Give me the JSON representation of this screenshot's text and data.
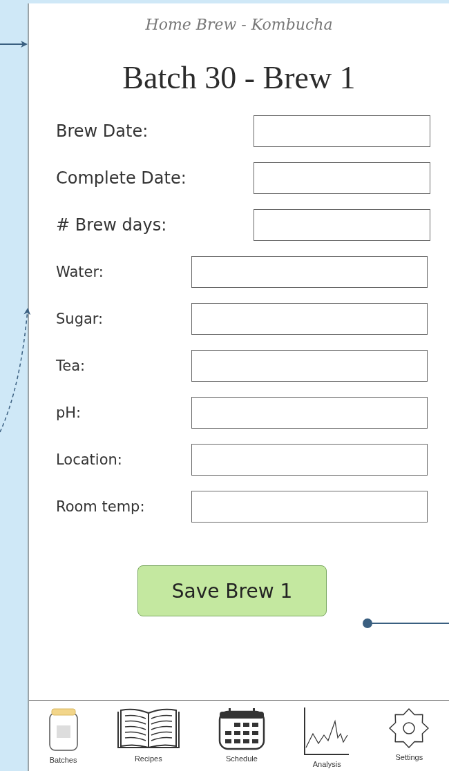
{
  "app_title": "Home Brew - Kombucha",
  "heading": "Batch 30 - Brew 1",
  "date_fields": [
    {
      "label": "Brew Date:"
    },
    {
      "label": "Complete Date:"
    },
    {
      "label": "# Brew days:"
    }
  ],
  "batch_fields": [
    {
      "label": "Water:"
    },
    {
      "label": "Sugar:"
    },
    {
      "label": "Tea:"
    },
    {
      "label": "pH:"
    },
    {
      "label": "Location:"
    },
    {
      "label": "Room temp:"
    }
  ],
  "save_button": "Save Brew 1",
  "nav": [
    {
      "kind": "jar",
      "label": "Batches"
    },
    {
      "kind": "book",
      "label": "Recipes"
    },
    {
      "kind": "calendar",
      "label": "Schedule"
    },
    {
      "kind": "chart",
      "label": "Analysis"
    },
    {
      "kind": "gear",
      "label": "Settings"
    }
  ]
}
